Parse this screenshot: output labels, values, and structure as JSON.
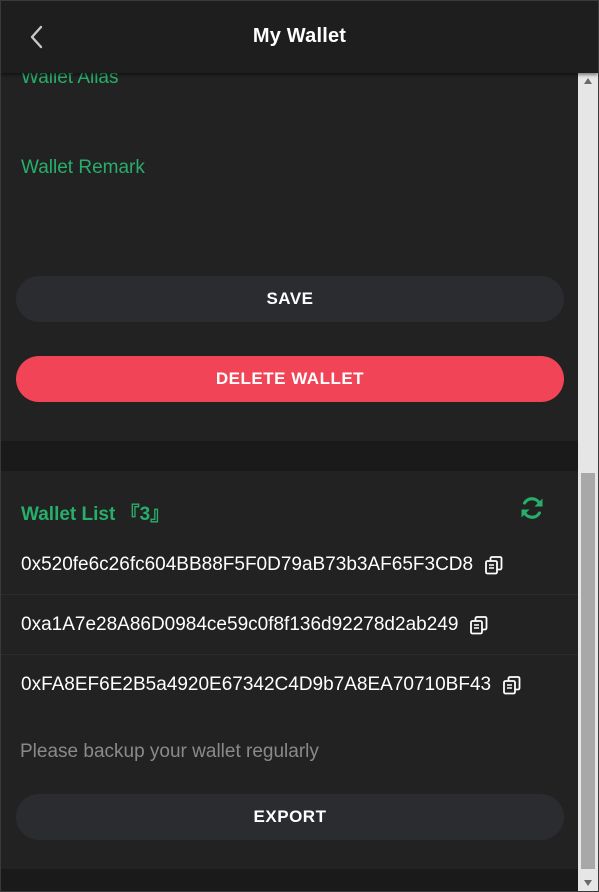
{
  "header": {
    "title": "My Wallet",
    "back_icon": "chevron-left-icon"
  },
  "wallet_form": {
    "alias_label": "Wallet Alias",
    "remark_label": "Wallet Remark",
    "save_label": "SAVE",
    "delete_label": "DELETE WALLET"
  },
  "wallet_list": {
    "title": "Wallet List 『3』",
    "refresh_icon": "refresh-icon",
    "copy_icon": "copy-icon",
    "addresses": [
      "0x520fe6c26fc604BB88F5F0D79aB73b3AF65F3CD8",
      "0xa1A7e28A86D0984ce59c0f8f136d92278d2ab249",
      "0xFA8EF6E2B5a4920E67342C4D9b7A8EA70710BF43"
    ],
    "backup_note": "Please backup your wallet regularly",
    "export_label": "EXPORT"
  },
  "colors": {
    "accent_green": "#27ae6a",
    "danger_red": "#f24457",
    "background": "#222223",
    "button_dark": "#2b2c30"
  }
}
